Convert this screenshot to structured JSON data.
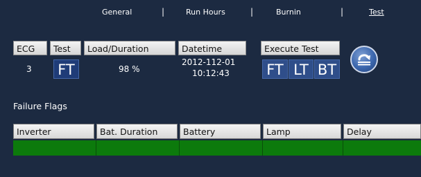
{
  "nav": {
    "items": [
      "General",
      "Run Hours",
      "Burnin",
      "Test"
    ],
    "separator": "|",
    "active": "Test"
  },
  "headers": {
    "ecg": "ECG",
    "test": "Test",
    "load_duration": "Load/Duration",
    "datetime": "Datetime",
    "execute_test": "Execute Test"
  },
  "values": {
    "ecg": "3",
    "test": "FT",
    "load_duration": "98 %",
    "date": "2012-112-01",
    "time": "10:12:43"
  },
  "execute_buttons": [
    "FT",
    "LT",
    "BT"
  ],
  "failure_flags": {
    "title": "Failure Flags",
    "columns": [
      "Inverter",
      "Bat. Duration",
      "Battery",
      "Lamp",
      "Delay"
    ],
    "flag_color": "#0c7a0c"
  },
  "icons": {
    "run_button": "redo-arrow-icon"
  }
}
